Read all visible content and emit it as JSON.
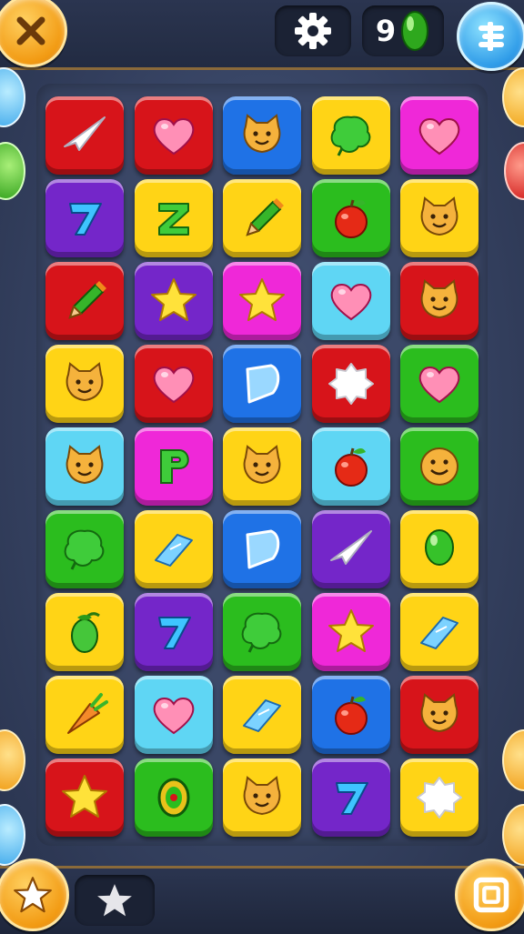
{
  "header": {
    "gem_count": "9"
  },
  "colors": {
    "red": "#d7141a",
    "yellow": "#ffd416",
    "blue": "#1f72e6",
    "purple": "#7426c9",
    "pink": "#ef28d8",
    "green": "#2bbd1e",
    "cyan": "#5fd6f4"
  },
  "board": {
    "rows": 9,
    "cols": 5,
    "tiles": [
      {
        "color": "red",
        "icon": "paper-plane"
      },
      {
        "color": "red",
        "icon": "heart"
      },
      {
        "color": "blue",
        "icon": "cat-face"
      },
      {
        "color": "yellow",
        "icon": "leaf-blob"
      },
      {
        "color": "pink",
        "icon": "heart"
      },
      {
        "color": "purple",
        "icon": "seven"
      },
      {
        "color": "yellow",
        "icon": "letter-z"
      },
      {
        "color": "yellow",
        "icon": "pencil"
      },
      {
        "color": "green",
        "icon": "apple"
      },
      {
        "color": "yellow",
        "icon": "cat-face"
      },
      {
        "color": "red",
        "icon": "pencil"
      },
      {
        "color": "purple",
        "icon": "star"
      },
      {
        "color": "pink",
        "icon": "star"
      },
      {
        "color": "cyan",
        "icon": "heart"
      },
      {
        "color": "red",
        "icon": "cat-face"
      },
      {
        "color": "yellow",
        "icon": "cat-face"
      },
      {
        "color": "red",
        "icon": "heart"
      },
      {
        "color": "blue",
        "icon": "crystal"
      },
      {
        "color": "red",
        "icon": "cloud-star"
      },
      {
        "color": "green",
        "icon": "heart"
      },
      {
        "color": "cyan",
        "icon": "cat-face"
      },
      {
        "color": "pink",
        "icon": "letter-p"
      },
      {
        "color": "yellow",
        "icon": "cat-face"
      },
      {
        "color": "cyan",
        "icon": "apple"
      },
      {
        "color": "green",
        "icon": "smiley"
      },
      {
        "color": "green",
        "icon": "leaf-blob"
      },
      {
        "color": "yellow",
        "icon": "ribbon"
      },
      {
        "color": "blue",
        "icon": "crystal"
      },
      {
        "color": "purple",
        "icon": "paper-plane"
      },
      {
        "color": "yellow",
        "icon": "balloon"
      },
      {
        "color": "yellow",
        "icon": "olive"
      },
      {
        "color": "purple",
        "icon": "seven"
      },
      {
        "color": "green",
        "icon": "leaf-blob"
      },
      {
        "color": "pink",
        "icon": "star"
      },
      {
        "color": "yellow",
        "icon": "ribbon"
      },
      {
        "color": "yellow",
        "icon": "carrot"
      },
      {
        "color": "cyan",
        "icon": "heart"
      },
      {
        "color": "yellow",
        "icon": "ribbon"
      },
      {
        "color": "blue",
        "icon": "apple"
      },
      {
        "color": "red",
        "icon": "cat-face"
      },
      {
        "color": "red",
        "icon": "star"
      },
      {
        "color": "green",
        "icon": "ring"
      },
      {
        "color": "yellow",
        "icon": "cat-face"
      },
      {
        "color": "purple",
        "icon": "seven"
      },
      {
        "color": "yellow",
        "icon": "cloud-star"
      }
    ]
  }
}
